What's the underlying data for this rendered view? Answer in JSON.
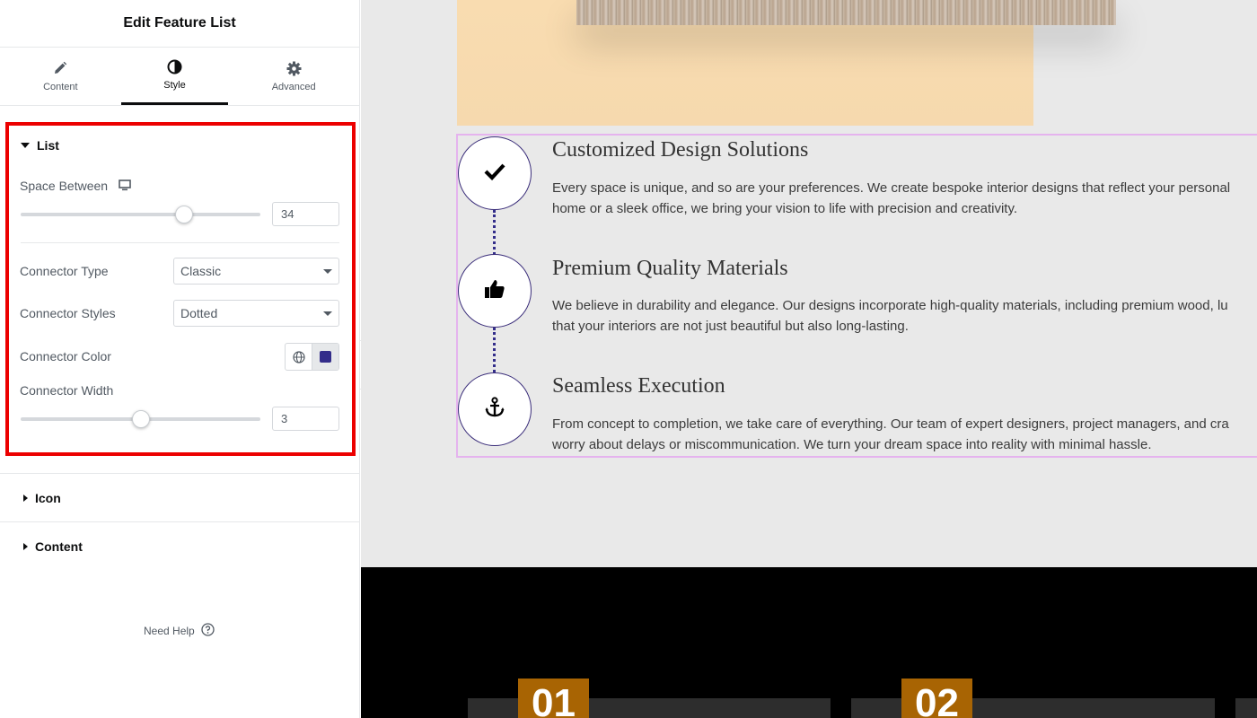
{
  "panel": {
    "title": "Edit Feature List",
    "tabs": [
      {
        "label": "Content",
        "icon": "pencil-icon",
        "active": false
      },
      {
        "label": "Style",
        "icon": "half-circle-icon",
        "active": true
      },
      {
        "label": "Advanced",
        "icon": "gear-icon",
        "active": false
      }
    ],
    "list_section": {
      "title": "List",
      "space_between": {
        "label": "Space Between",
        "device_icon": "desktop-icon",
        "value": "34",
        "slider_fraction": 0.68
      },
      "connector_type": {
        "label": "Connector Type",
        "value": "Classic"
      },
      "connector_styles": {
        "label": "Connector Styles",
        "value": "Dotted"
      },
      "connector_color": {
        "label": "Connector Color",
        "value": "#332d8a"
      },
      "connector_width": {
        "label": "Connector Width",
        "value": "3",
        "slider_fraction": 0.5
      }
    },
    "icon_section": {
      "title": "Icon"
    },
    "content_section": {
      "title": "Content"
    },
    "need_help": "Need Help"
  },
  "canvas": {
    "features": [
      {
        "icon": "check-icon",
        "title": "Customized Design Solutions",
        "desc_line1": "Every space is unique, and so are your preferences. We create bespoke interior designs that reflect your personal",
        "desc_line2": "home or a sleek office, we bring your vision to life with precision and creativity."
      },
      {
        "icon": "thumbs-up-icon",
        "title": "Premium Quality Materials",
        "desc_line1": "We believe in durability and elegance. Our designs incorporate high-quality materials, including premium wood, lu",
        "desc_line2": "that your interiors are not just beautiful but also long-lasting."
      },
      {
        "icon": "anchor-icon",
        "title": "Seamless Execution",
        "desc_line1": "From concept to completion, we take care of everything. Our team of expert designers, project managers, and cra",
        "desc_line2": "worry about delays or miscommunication. We turn your dream space into reality with minimal hassle."
      }
    ],
    "steps": [
      "01",
      "02"
    ]
  },
  "colors": {
    "accent_red": "#ec0000",
    "connector": "#332d8a",
    "badge": "#a86403",
    "peach": "#f9dcb0"
  }
}
